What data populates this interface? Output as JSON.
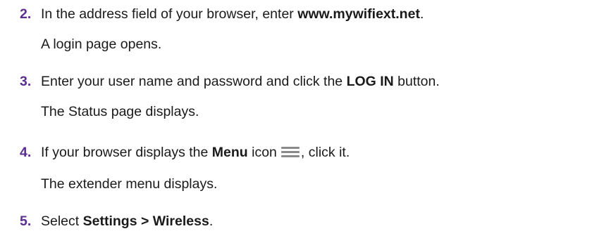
{
  "steps": [
    {
      "number": "2.",
      "text_before": "In the address field of your browser, enter ",
      "bold": "www.mywifiext.net",
      "text_after": ".",
      "result": "A login page opens."
    },
    {
      "number": "3.",
      "text_before": "Enter your user name and password and click the ",
      "bold": "LOG IN",
      "text_after": " button.",
      "result": "The Status page displays."
    },
    {
      "number": "4.",
      "text_before": "If your browser displays the ",
      "bold": "Menu",
      "text_mid": " icon",
      "icon": "menu-icon",
      "text_after": ", click it.",
      "result": "The extender menu displays."
    },
    {
      "number": "5.",
      "text_before": "Select ",
      "bold": "Settings > Wireless",
      "text_after": "."
    }
  ],
  "colors": {
    "step_number": "#5c2d91",
    "text": "#1a1a1a",
    "icon": "#8a8a8a"
  }
}
